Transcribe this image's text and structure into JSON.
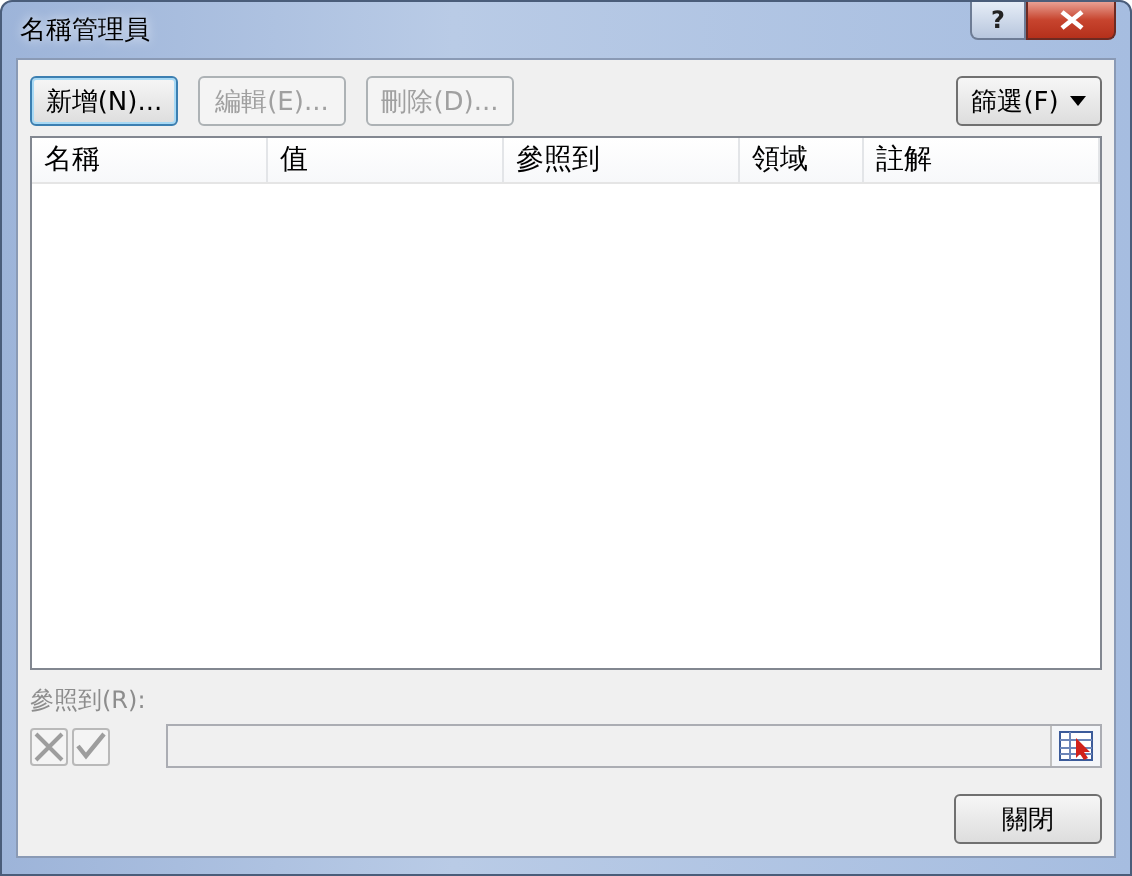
{
  "window": {
    "title": "名稱管理員",
    "help_button": "?"
  },
  "toolbar": {
    "buttons": [
      {
        "label": "新增(N)...",
        "disabled": false,
        "default": true
      },
      {
        "label": "編輯(E)...",
        "disabled": true,
        "default": false
      },
      {
        "label": "刪除(D)...",
        "disabled": true,
        "default": false
      }
    ],
    "filter_button": {
      "label": "篩選(F)",
      "disabled": false
    }
  },
  "table": {
    "columns": [
      "名稱",
      "值",
      "參照到",
      "領域",
      "註解"
    ]
  },
  "refers_to": {
    "label": "參照到(R):",
    "disabled": true,
    "cancel_disabled": true,
    "confirm_disabled": true
  },
  "footer": {
    "close_button": "關閉"
  }
}
